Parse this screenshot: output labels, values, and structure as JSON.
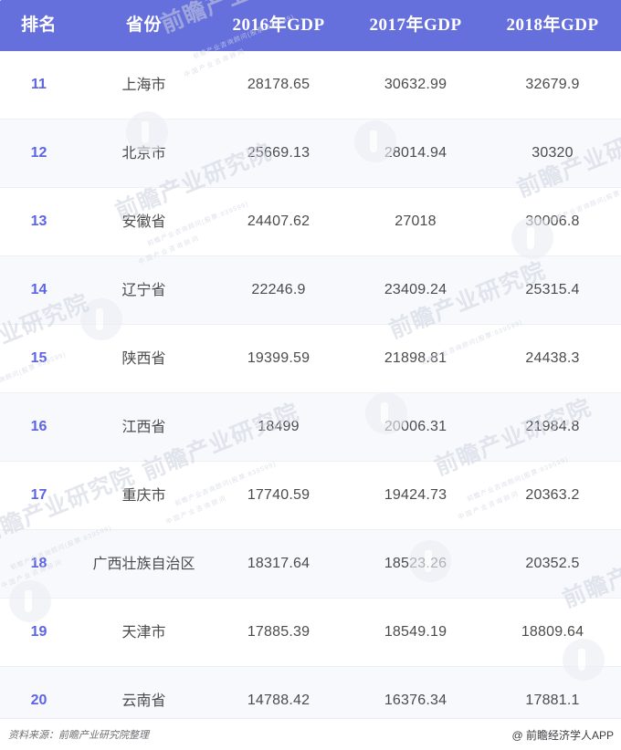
{
  "table": {
    "columns": [
      {
        "key": "rank",
        "label": "排名"
      },
      {
        "key": "province",
        "label": "省份"
      },
      {
        "key": "gdp2016",
        "label": "2016年GDP"
      },
      {
        "key": "gdp2017",
        "label": "2017年GDP"
      },
      {
        "key": "gdp2018",
        "label": "2018年GDP"
      }
    ],
    "rows": [
      {
        "rank": "11",
        "province": "上海市",
        "gdp2016": "28178.65",
        "gdp2017": "30632.99",
        "gdp2018": "32679.9"
      },
      {
        "rank": "12",
        "province": "北京市",
        "gdp2016": "25669.13",
        "gdp2017": "28014.94",
        "gdp2018": "30320"
      },
      {
        "rank": "13",
        "province": "安徽省",
        "gdp2016": "24407.62",
        "gdp2017": "27018",
        "gdp2018": "30006.8"
      },
      {
        "rank": "14",
        "province": "辽宁省",
        "gdp2016": "22246.9",
        "gdp2017": "23409.24",
        "gdp2018": "25315.4"
      },
      {
        "rank": "15",
        "province": "陕西省",
        "gdp2016": "19399.59",
        "gdp2017": "21898.81",
        "gdp2018": "24438.3"
      },
      {
        "rank": "16",
        "province": "江西省",
        "gdp2016": "18499",
        "gdp2017": "20006.31",
        "gdp2018": "21984.8"
      },
      {
        "rank": "17",
        "province": "重庆市",
        "gdp2016": "17740.59",
        "gdp2017": "19424.73",
        "gdp2018": "20363.2"
      },
      {
        "rank": "18",
        "province": "广西壮族自治区",
        "gdp2016": "18317.64",
        "gdp2017": "18523.26",
        "gdp2018": "20352.5"
      },
      {
        "rank": "19",
        "province": "天津市",
        "gdp2016": "17885.39",
        "gdp2017": "18549.19",
        "gdp2018": "18809.64"
      },
      {
        "rank": "20",
        "province": "云南省",
        "gdp2016": "14788.42",
        "gdp2017": "16376.34",
        "gdp2018": "17881.1"
      }
    ]
  },
  "footer": {
    "source": "资料来源：前瞻产业研究院整理",
    "app": "@ 前瞻经济学人APP"
  },
  "watermark": {
    "main": "前瞻产业研究院",
    "sub": "中国产业咨询顾问",
    "code": "前瞻产业咨询顾问(股票:839599)"
  },
  "colors": {
    "header_bg": "#6670dc",
    "rank_text": "#5b63e6",
    "row_alt_bg": "#f8f9fc",
    "body_text": "#4b4b4d"
  }
}
